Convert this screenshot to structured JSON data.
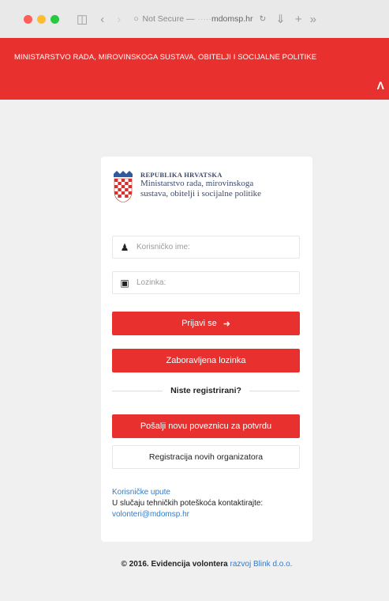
{
  "browser": {
    "window_controls": [
      {
        "name": "close",
        "color": "#fd5f57"
      },
      {
        "name": "minimize",
        "color": "#febc2e"
      },
      {
        "name": "maximize",
        "color": "#28c840"
      }
    ],
    "address_prefix": "Not Secure —",
    "address_host": "mdomsp.hr"
  },
  "header": {
    "title": "MINISTARSTVO RADA, MIROVINSKOGA SUSTAVA, OBITELJI I SOCIJALNE POLITIKE",
    "color": "#e8302f"
  },
  "logo": {
    "line1": "REPUBLIKA HRVATSKA",
    "line2": "Ministarstvo rada, mirovinskoga",
    "line3": "sustava, obitelji i socijalne politike"
  },
  "login": {
    "username_placeholder": "Korisničko ime:",
    "password_placeholder": "Lozinka:",
    "login_button": "Prijavi se",
    "forgot_button": "Zaboravljena lozinka",
    "not_registered": "Niste registrirani?",
    "resend_button": "Pošalji novu poveznicu za potvrdu",
    "register_button": "Registracija novih organizatora"
  },
  "help": {
    "guide_link": "Korisničke upute",
    "contact_text": "U slučaju tehničkih poteškoća kontaktirajte:",
    "email": "volonteri@mdomsp.hr"
  },
  "footer": {
    "copyright": "© 2016. Evidencija volontera",
    "dev_link": "razvoj Blink d.o.o."
  }
}
